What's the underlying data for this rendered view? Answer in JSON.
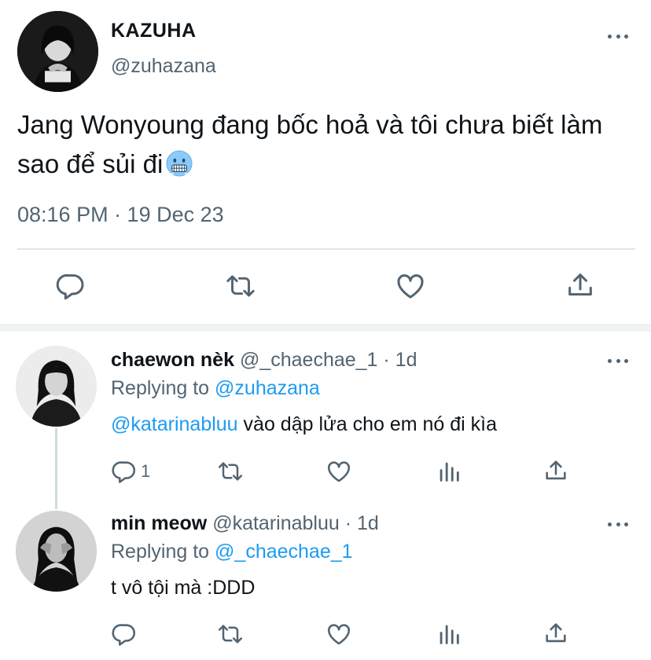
{
  "main_tweet": {
    "display_name": "KAZUHA",
    "handle": "@zuhazana",
    "text": "Jang Wonyoung đang bốc hoả và tôi chưa biết làm sao để sủi đi",
    "emoji": "cold-face-emoji",
    "timestamp": "08:16 PM · 19 Dec 23",
    "actions": [
      "reply-icon",
      "retweet-icon",
      "like-icon",
      "share-icon"
    ]
  },
  "replies": [
    {
      "display_name": "chaewon nèk",
      "handle_time": "@_chaechae_1 · 1d",
      "replying_prefix": "Replying to",
      "replying_handle": "@zuhazana",
      "mention": "@katarinabluu",
      "text": " vào dập lửa cho em nó đi kìa",
      "reply_count": "1",
      "actions": [
        "reply-icon",
        "retweet-icon",
        "like-icon",
        "views-icon",
        "share-icon"
      ]
    },
    {
      "display_name": "min meow",
      "handle_time": "@katarinabluu · 1d",
      "replying_prefix": "Replying to",
      "replying_handle": "@_chaechae_1",
      "text": "t vô tội mà :DDD",
      "actions": [
        "reply-icon",
        "retweet-icon",
        "like-icon",
        "views-icon",
        "share-icon"
      ]
    }
  ],
  "colors": {
    "text": "#0f1419",
    "secondary": "#536471",
    "link": "#1d9bf0",
    "divider": "#e1e6ea"
  }
}
